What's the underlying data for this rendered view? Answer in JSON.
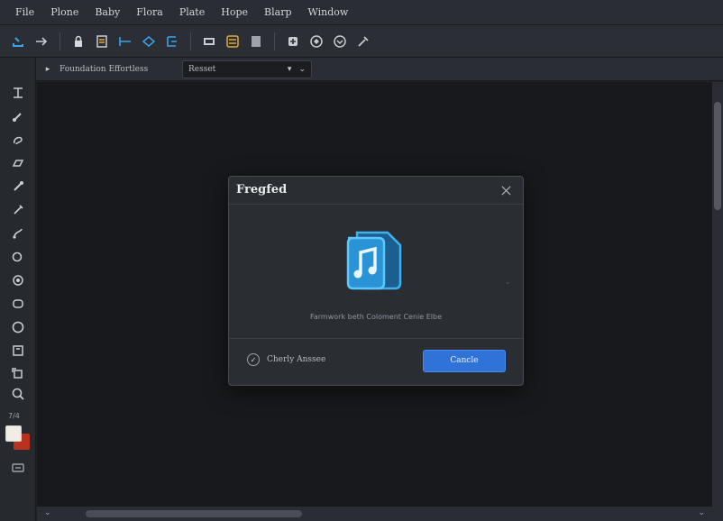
{
  "menubar": {
    "items": [
      "File",
      "Plone",
      "Baby",
      "Flora",
      "Plate",
      "Hope",
      "Blarp",
      "Window"
    ]
  },
  "toolbar": {
    "icons": [
      "import-icon",
      "arrow-right-icon",
      "lock-icon",
      "document-icon",
      "line-tool-icon",
      "diamond-icon",
      "frame-icon",
      "layers-icon",
      "grid-icon",
      "panel-icon",
      "add-icon",
      "target-icon",
      "shield-icon",
      "brush-icon"
    ]
  },
  "options": {
    "label": "Foundation Effortless",
    "select_value": "Resset"
  },
  "tools": {
    "swatch_label": "7/4",
    "icons": [
      "text-tool-icon",
      "brush-tool-icon",
      "lasso-tool-icon",
      "eraser-tool-icon",
      "pen-tool-icon",
      "pencil-tool-icon",
      "curve-tool-icon",
      "ellipse-tool-icon",
      "blob-tool-icon",
      "shape-tool-icon",
      "circle-tool-icon",
      "crop-tool-icon",
      "stamp-tool-icon",
      "zoom-tool-icon",
      "more-tool-icon"
    ]
  },
  "dialog": {
    "title": "Fregfed",
    "message": "Farmwork beth Coloment Cenie Elbe",
    "checkbox_label": "Cherly Anssee",
    "cancel_label": "Cancle"
  },
  "colors": {
    "accent": "#2f72d8",
    "icon_blue": "#3aa3e8",
    "foreground_swatch": "#f1ece6",
    "background_swatch": "#b9321f"
  }
}
